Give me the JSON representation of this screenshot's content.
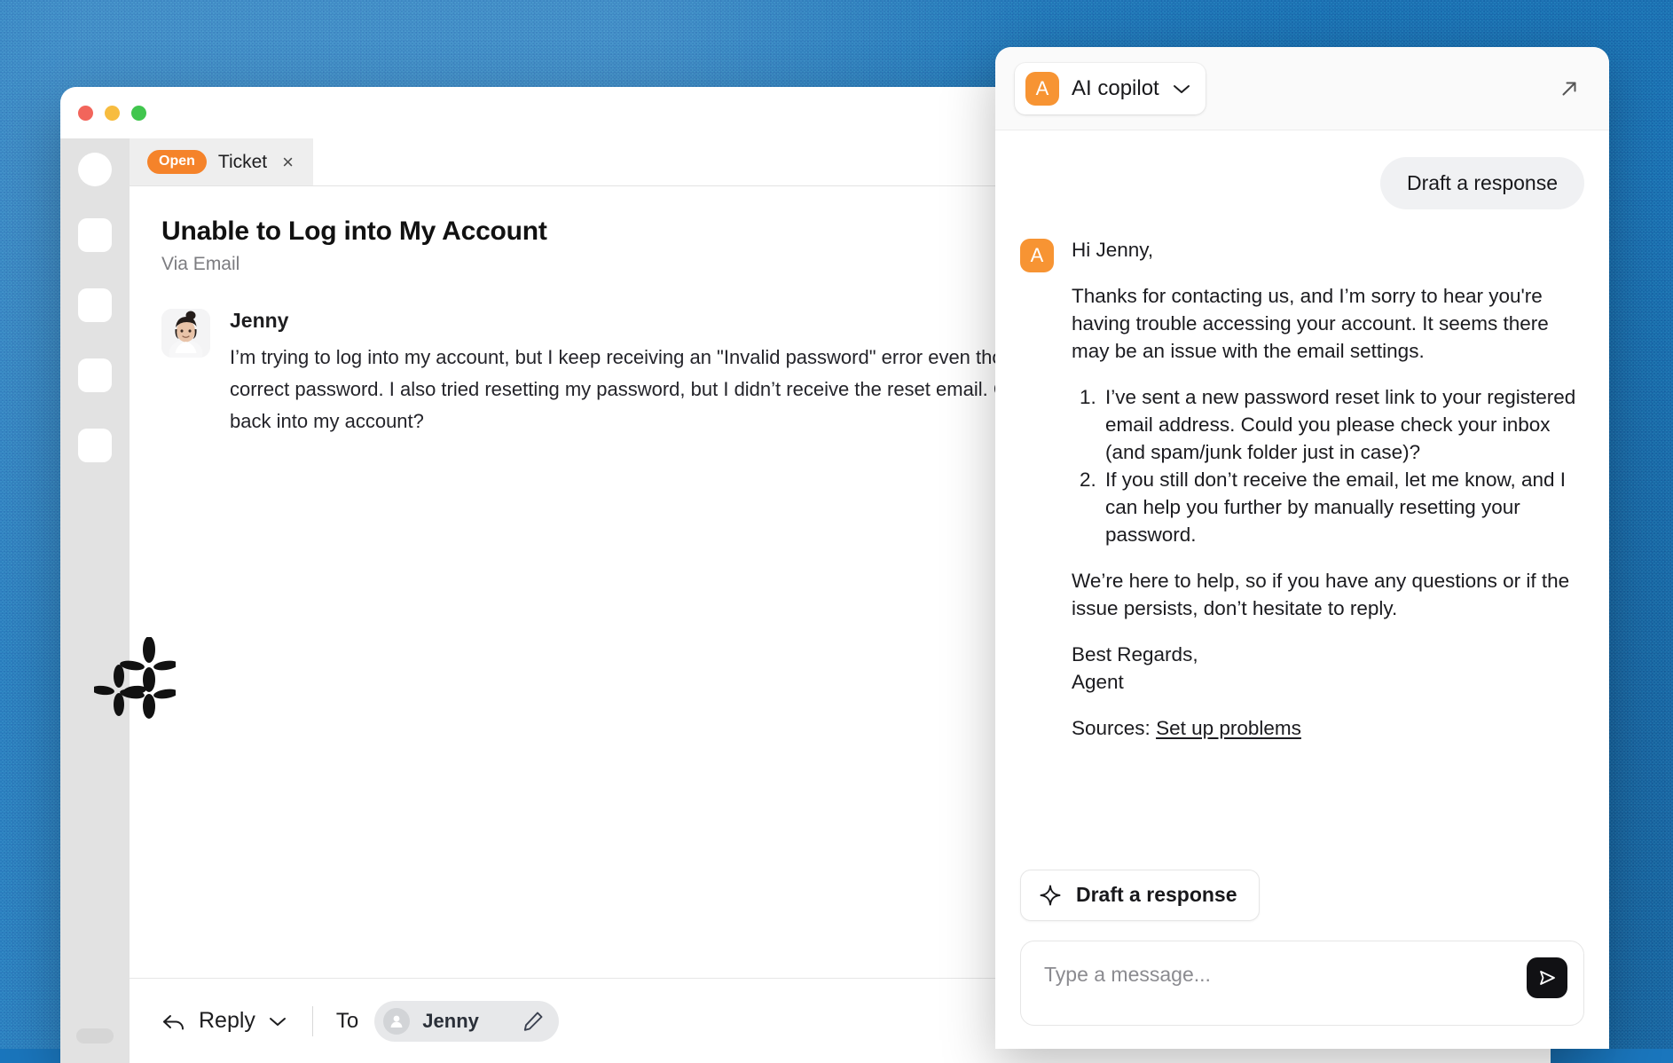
{
  "window": {
    "traffic_lights": [
      "close",
      "minimize",
      "zoom"
    ]
  },
  "sidebar": {
    "items": [
      "rail-item-1",
      "rail-item-2",
      "rail-item-3",
      "rail-item-4"
    ]
  },
  "tabbar": {
    "status_badge": "Open",
    "tab_label": "Ticket",
    "close_glyph": "×"
  },
  "ticket": {
    "title": "Unable to Log into My Account",
    "via": "Via Email",
    "message": {
      "author": "Jenny",
      "text": "I’m trying to log into my account, but I keep receiving an \"Invalid password\" error even though I’m sure I’m using the correct password. I also tried resetting my password, but I didn’t receive the reset email. Could you please help me get back into my account?"
    }
  },
  "reply_bar": {
    "reply_label": "Reply",
    "to_label": "To",
    "recipient": "Jenny"
  },
  "copilot": {
    "avatar_initial": "A",
    "title": "AI copilot",
    "accent_color": "#f79433",
    "user_message": "Draft a response",
    "response": {
      "greeting": "Hi Jenny,",
      "intro": "Thanks for contacting us, and I’m sorry to hear you're having trouble accessing your account. It seems there may be an issue with the email settings.",
      "steps": [
        "I’ve sent a new password reset link to your registered email address. Could you please check your inbox (and spam/junk folder just in case)?",
        "If you still don’t receive the email, let me know, and I can help you further by manually resetting your password."
      ],
      "closing": "We’re here to help, so if you have any questions or if the issue persists, don’t hesitate to reply.",
      "signoff_line1": "Best Regards,",
      "signoff_line2": "Agent",
      "sources_label": "Sources:",
      "sources_link": "Set up problems"
    },
    "draft_button": "Draft a response",
    "composer_placeholder": "Type a message..."
  },
  "colors": {
    "backdrop_blue": "#1a76bd",
    "status_orange": "#f5832a",
    "copilot_orange": "#f79433",
    "send_button": "#111114"
  }
}
